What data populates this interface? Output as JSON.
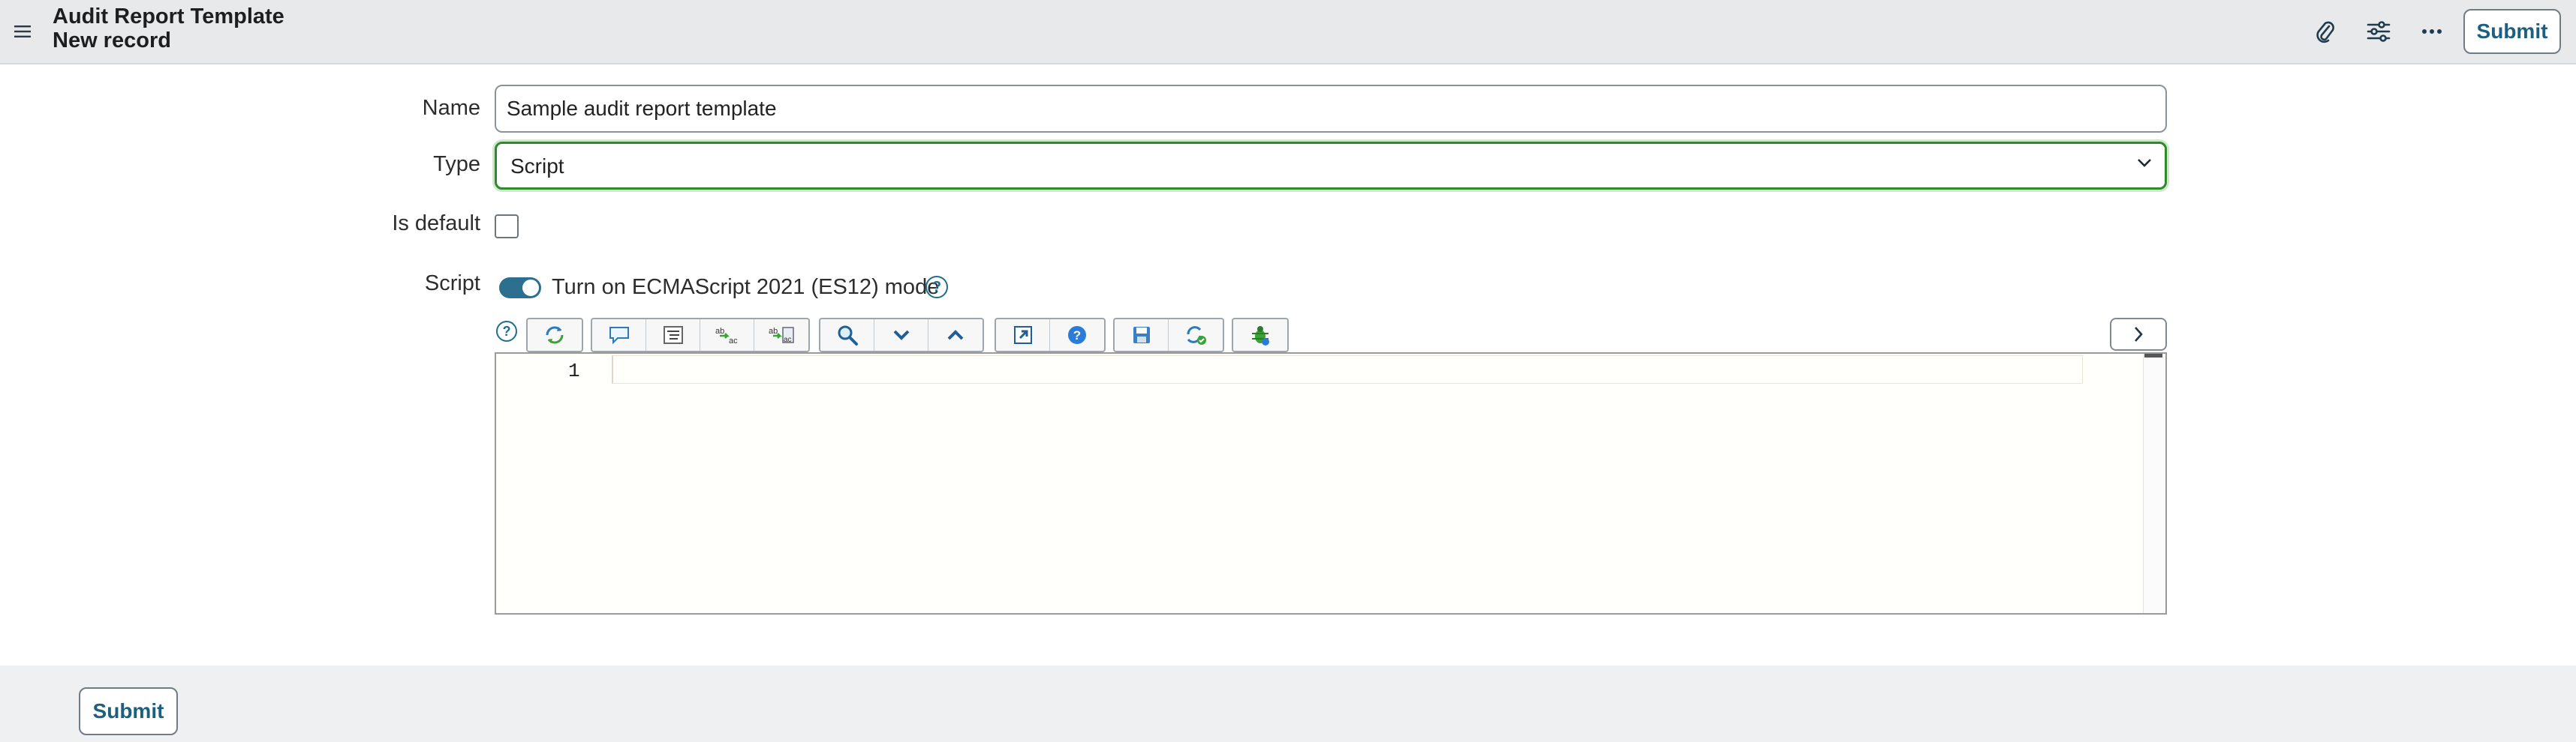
{
  "header": {
    "title": "Audit Report Template",
    "subtitle": "New record",
    "submit_label": "Submit",
    "menu_icon": "hamburger-icon",
    "attach_icon": "paperclip-icon",
    "settings_icon": "sliders-icon",
    "more_icon": "ellipsis-icon"
  },
  "form": {
    "name_label": "Name",
    "name_value": "Sample audit report template",
    "type_label": "Type",
    "type_value": "Script",
    "is_default_label": "Is default",
    "is_default_checked": false,
    "script_label": "Script",
    "es_mode_label": "Turn on ECMAScript 2021 (ES12) mode",
    "es_mode_on": true
  },
  "editor": {
    "line_numbers": [
      "1"
    ],
    "content": ""
  },
  "footer": {
    "submit_label": "Submit"
  },
  "colors": {
    "accent": "#1d5f7e",
    "focus_border": "#2e8a2a",
    "toggle_on": "#2c6f8f"
  }
}
